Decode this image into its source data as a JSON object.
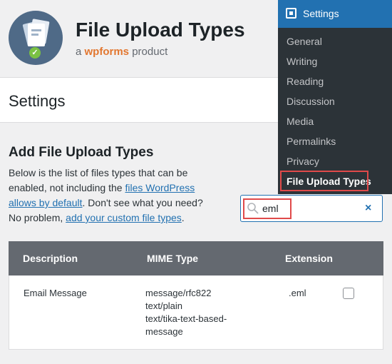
{
  "header": {
    "title": "File Upload Types",
    "byline_prefix": "a",
    "brand": "wpforms",
    "byline_suffix": "product"
  },
  "settings_bar": {
    "title": "Settings"
  },
  "main": {
    "section_title": "Add File Upload Types",
    "desc_part1": "Below is the list of files types that can be enabled, not including the ",
    "desc_link1": "files WordPress allows by default",
    "desc_part2": ". Don't see what you need? No problem, ",
    "desc_link2": "add your custom file types",
    "desc_part3": "."
  },
  "search": {
    "value": "eml",
    "clear_icon": "×"
  },
  "table": {
    "headers": {
      "description": "Description",
      "mime": "MIME Type",
      "extension": "Extension"
    },
    "rows": [
      {
        "description": "Email Message",
        "mime_lines": [
          "message/rfc822",
          "text/plain",
          "text/tika-text-based-",
          "message"
        ],
        "extension": ".eml",
        "checked": false
      }
    ]
  },
  "admin_menu": {
    "header": "Settings",
    "items": [
      "General",
      "Writing",
      "Reading",
      "Discussion",
      "Media",
      "Permalinks",
      "Privacy",
      "File Upload Types"
    ],
    "active_index": 7
  },
  "colors": {
    "accent": "#2271b1",
    "menu_bg": "#2c3338",
    "highlight": "#e04a4a",
    "table_header": "#646970",
    "brand": "#e27730"
  }
}
